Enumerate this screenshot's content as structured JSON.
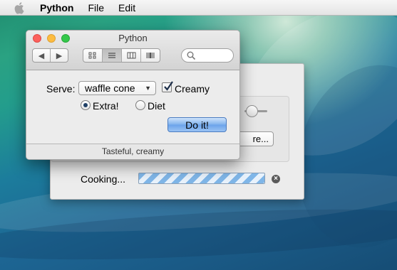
{
  "menubar": {
    "app_name": "Python",
    "items": [
      "File",
      "Edit"
    ]
  },
  "front_window": {
    "title": "Python",
    "toolbar": {
      "nav_icons": [
        "back-arrow-icon",
        "forward-arrow-icon"
      ],
      "view_icons": [
        "icon-view-icon",
        "list-view-icon",
        "column-view-icon",
        "coverflow-view-icon"
      ],
      "active_view": "list-view-icon",
      "search_placeholder": ""
    },
    "form": {
      "serve_label": "Serve:",
      "serve_value": "waffle cone",
      "creamy_label": "Creamy",
      "creamy_checked": true,
      "options": [
        "Extra!",
        "Diet"
      ],
      "selected_option": "Extra!",
      "action_label": "Do it!"
    },
    "status_text": "Tasteful, creamy"
  },
  "back_window": {
    "partial_button_label": "re...",
    "progress_label": "Cooking...",
    "progress_state": "indeterminate"
  },
  "colors": {
    "accent_button": "#7fb1ed",
    "progress_stripe": "#7fb6e8",
    "close": "#fc605c",
    "minimize": "#fdbc40",
    "zoom": "#34c84a"
  }
}
